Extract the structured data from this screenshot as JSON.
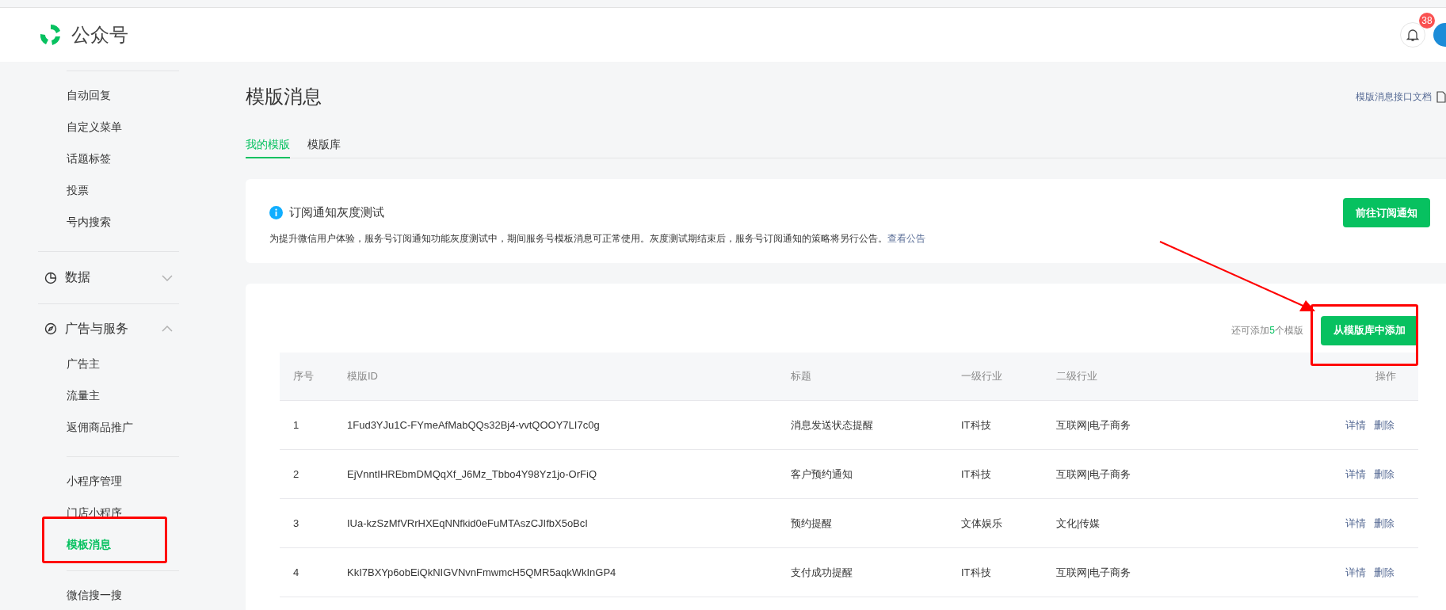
{
  "header": {
    "brand": "公众号",
    "notifications": "38"
  },
  "sidebar": {
    "groups": [
      {
        "items": [
          {
            "label": "自动回复",
            "selected": false
          },
          {
            "label": "自定义菜单",
            "selected": false
          },
          {
            "label": "话题标签",
            "selected": false
          },
          {
            "label": "投票",
            "selected": false
          },
          {
            "label": "号内搜索",
            "selected": false
          }
        ]
      },
      {
        "header": {
          "label": "数据",
          "expanded": false
        }
      },
      {
        "header": {
          "label": "广告与服务",
          "expanded": true
        },
        "items": [
          {
            "label": "广告主",
            "selected": false
          },
          {
            "label": "流量主",
            "selected": false
          },
          {
            "label": "返佣商品推广",
            "selected": false
          }
        ]
      },
      {
        "items": [
          {
            "label": "小程序管理",
            "selected": false
          },
          {
            "label": "门店小程序",
            "selected": false
          },
          {
            "label": "模板消息",
            "selected": true
          }
        ]
      },
      {
        "items": [
          {
            "label": "微信搜一搜",
            "selected": false
          }
        ]
      }
    ]
  },
  "page": {
    "title": "模版消息",
    "doc_link": "模版消息接口文档",
    "tabs": [
      {
        "label": "我的模版",
        "selected": true
      },
      {
        "label": "模版库",
        "selected": false
      }
    ]
  },
  "notice": {
    "title": "订阅通知灰度测试",
    "text": "为提升微信用户体验，服务号订阅通知功能灰度测试中，期间服务号模板消息可正常使用。灰度测试期结束后，服务号订阅通知的策略将另行公告。",
    "link": "查看公告",
    "button": "前往订阅通知"
  },
  "templates": {
    "quota_prefix": "还可添加",
    "quota_count": "5",
    "quota_suffix": "个模版",
    "add_button": "从模版库中添加",
    "columns": [
      "序号",
      "模版ID",
      "标题",
      "一级行业",
      "二级行业",
      "操作"
    ],
    "rows": [
      {
        "cells": [
          "1",
          "1Fud3YJu1C-FYmeAfMabQQs32Bj4-vvtQOOY7LI7c0g",
          "消息发送状态提醒",
          "IT科技",
          "互联网|电子商务"
        ],
        "actions": [
          "详情",
          "删除"
        ]
      },
      {
        "cells": [
          "2",
          "EjVnntIHREbmDMQqXf_J6Mz_Tbbo4Y98Yz1jo-OrFiQ",
          "客户预约通知",
          "IT科技",
          "互联网|电子商务"
        ],
        "actions": [
          "详情",
          "删除"
        ]
      },
      {
        "cells": [
          "3",
          "IUa-kzSzMfVRrHXEqNNfkid0eFuMTAszCJIfbX5oBcI",
          "预约提醒",
          "文体娱乐",
          "文化|传媒"
        ],
        "actions": [
          "详情",
          "删除"
        ]
      },
      {
        "cells": [
          "4",
          "KkI7BXYp6obEiQkNIGVNvnFmwmcH5QMR5aqkWkInGP4",
          "支付成功提醒",
          "IT科技",
          "互联网|电子商务"
        ],
        "actions": [
          "详情",
          "删除"
        ]
      }
    ]
  }
}
